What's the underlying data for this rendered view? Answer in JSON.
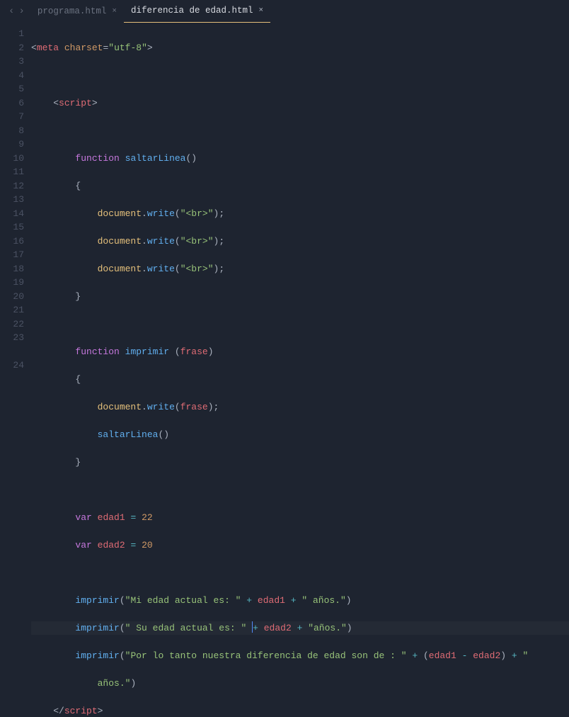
{
  "nav": {
    "back": "‹",
    "forward": "›"
  },
  "tabs": [
    {
      "label": "programa.html",
      "active": false
    },
    {
      "label": "diferencia de edad.html",
      "active": true
    }
  ],
  "close_glyph": "×",
  "gutter": [
    "1",
    "2",
    "3",
    "4",
    "5",
    "6",
    "7",
    "8",
    "9",
    "10",
    "11",
    "12",
    "13",
    "14",
    "15",
    "16",
    "17",
    "18",
    "19",
    "20",
    "21",
    "22",
    "23",
    "",
    "24"
  ],
  "code": {
    "l1": {
      "open": "<",
      "tag": "meta",
      "sp": " ",
      "attr": "charset",
      "eq": "=",
      "val": "\"utf-8\"",
      "close": ">"
    },
    "l3": {
      "indent": "    ",
      "open": "<",
      "tag": "script",
      "close": ">"
    },
    "l5": {
      "indent": "        ",
      "kw": "function",
      "sp": " ",
      "name": "saltarLinea",
      "paren": "()"
    },
    "l6": {
      "indent": "        ",
      "brace": "{"
    },
    "l7": {
      "indent": "            ",
      "obj": "document",
      "dot": ".",
      "fn": "write",
      "lp": "(",
      "str": "\"<br>\"",
      "rp": ")",
      "semi": ";"
    },
    "l8": {
      "indent": "            ",
      "obj": "document",
      "dot": ".",
      "fn": "write",
      "lp": "(",
      "str": "\"<br>\"",
      "rp": ")",
      "semi": ";"
    },
    "l9": {
      "indent": "            ",
      "obj": "document",
      "dot": ".",
      "fn": "write",
      "lp": "(",
      "str": "\"<br>\"",
      "rp": ")",
      "semi": ";"
    },
    "l10": {
      "indent": "        ",
      "brace": "}"
    },
    "l12": {
      "indent": "        ",
      "kw": "function",
      "sp": " ",
      "name": "imprimir",
      "sp2": " ",
      "lp": "(",
      "param": "frase",
      "rp": ")"
    },
    "l13": {
      "indent": "        ",
      "brace": "{"
    },
    "l14": {
      "indent": "            ",
      "obj": "document",
      "dot": ".",
      "fn": "write",
      "lp": "(",
      "arg": "frase",
      "rp": ")",
      "semi": ";"
    },
    "l15": {
      "indent": "            ",
      "fn": "saltarLinea",
      "paren": "()"
    },
    "l16": {
      "indent": "        ",
      "brace": "}"
    },
    "l18": {
      "indent": "        ",
      "kw": "var",
      "sp": " ",
      "name": "edad1",
      "sp2": " ",
      "op": "=",
      "sp3": " ",
      "num": "22"
    },
    "l19": {
      "indent": "        ",
      "kw": "var",
      "sp": " ",
      "name": "edad2",
      "sp2": " ",
      "op": "=",
      "sp3": " ",
      "num": "20"
    },
    "l21": {
      "indent": "        ",
      "fn": "imprimir",
      "lp": "(",
      "s1": "\"Mi edad actual es: \"",
      "sp1": " ",
      "op1": "+",
      "sp2": " ",
      "v1": "edad1",
      "sp3": " ",
      "op2": "+",
      "sp4": " ",
      "s2": "\" años.\"",
      "rp": ")"
    },
    "l22": {
      "indent": "        ",
      "fn": "imprimir",
      "lp": "(",
      "s1": "\" Su edad actual es: \"",
      "sp1": " ",
      "op1": "+",
      "sp2": " ",
      "v1": "edad2",
      "sp3": " ",
      "op2": "+",
      "sp4": " ",
      "s2": "\"años.\"",
      "rp": ")"
    },
    "l23a": {
      "indent": "        ",
      "fn": "imprimir",
      "lp": "(",
      "s1": "\"Por lo tanto nuestra diferencia de edad son de : \"",
      "sp1": " ",
      "op1": "+",
      "sp2": " ",
      "lp2": "(",
      "v1": "edad1",
      "sp3": " ",
      "op2": "-",
      "sp4": " ",
      "v2": "edad2",
      "rp2": ")",
      "sp5": " ",
      "op3": "+",
      "sp6": " ",
      "s2": "\""
    },
    "l23b": {
      "indent": "            ",
      "s": "años.\"",
      "rp": ")"
    },
    "l24": {
      "indent": "    ",
      "open": "</",
      "tag": "script",
      "close": ">"
    }
  }
}
